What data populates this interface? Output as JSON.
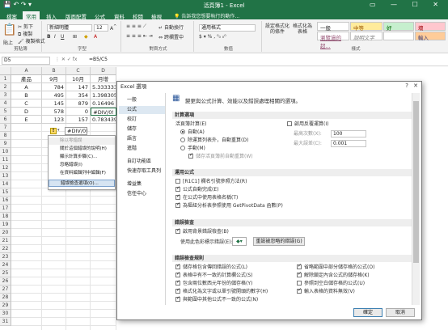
{
  "titlebar": {
    "title": "活頁簿1 - Excel"
  },
  "tabs": [
    "檔案",
    "常用",
    "插入",
    "版面配置",
    "公式",
    "資料",
    "校閱",
    "檢視",
    "說明"
  ],
  "tell_me": "告訴我您想要執行的動作...",
  "ribbon": {
    "paste": "貼上",
    "cut": "剪下",
    "copy": "複製",
    "format_painter": "複製格式",
    "clipboard_label": "剪貼簿",
    "font_name": "新細明體",
    "font_size": "12",
    "font_label": "字型",
    "wrap": "自動換行",
    "merge": "跨欄置中",
    "align_label": "對齊方式",
    "num_format": "通用格式",
    "num_label": "數值",
    "cond_format": "設定格式化的條件",
    "as_table": "格式化為表格",
    "styles": {
      "normal": "一般",
      "medium": "中等",
      "good": "好",
      "bad": "壞",
      "hyperlink": "瀏覽過的超...",
      "explanatory": "說明文字",
      "input": "輸入"
    },
    "styles_label": "樣式"
  },
  "formula_bar": {
    "name_box": "D5",
    "formula": "=B5/C5"
  },
  "sheet": {
    "cols": [
      "A",
      "B",
      "C",
      "D"
    ],
    "rows": [
      "1",
      "2",
      "3",
      "4",
      "5",
      "6",
      "7",
      "8",
      "9",
      "10",
      "11",
      "12",
      "13",
      "14",
      "15",
      "16",
      "17",
      "18",
      "19",
      "20",
      "21",
      "22",
      "23",
      "24",
      "25",
      "26",
      "27",
      "28",
      "29",
      "30",
      "31"
    ],
    "data": [
      [
        "產品",
        "9月",
        "10月",
        "月增"
      ],
      [
        "A",
        "784",
        "147",
        "5.333333"
      ],
      [
        "B",
        "495",
        "354",
        "1.398305"
      ],
      [
        "C",
        "145",
        "879",
        "0.16496"
      ],
      [
        "D",
        "578",
        "0",
        "#DIV/0!"
      ],
      [
        "E",
        "123",
        "157",
        "0.783439"
      ]
    ],
    "error_tag": "#DIV/0!"
  },
  "error_menu": [
    "除以零錯誤",
    "關於這個錯誤的說明(H)",
    "顯示計算步驟(C)...",
    "忽略錯誤(I)",
    "在資料編輯列中編輯(F)",
    "錯誤檢查選項(O)..."
  ],
  "dialog": {
    "title": "Excel 選項",
    "nav": [
      "一般",
      "公式",
      "校訂",
      "儲存",
      "語言",
      "進階",
      "自訂功能區",
      "快速存取工具列",
      "增益集",
      "信任中心"
    ],
    "header": "變更與公式計算、效能以及錯誤處理相關的選項。",
    "sec_calc": "計算選項",
    "workbook_calc": "活頁簿計算(E)",
    "calc_auto": "自動(A)",
    "calc_auto_except": "除運算列表外，自動重算(D)",
    "calc_manual": "手動(M)",
    "recalc_before_save": "儲存活頁簿前自動重算(W)",
    "iterative": "啟用反覆運算(I)",
    "max_iter_label": "最高次數(X):",
    "max_iter": "100",
    "max_change_label": "最大誤差(C):",
    "max_change": "0.001",
    "sec_formulas": "運用公式",
    "r1c1": "[R1C1] 欄名引號參照方法(R)",
    "autocomplete": "公式自動完成(E)",
    "table_names": "在公式中使用表格名稱(T)",
    "getpivot": "為樞紐分析表參照使用 GetPivotData 函數(P)",
    "sec_err": "錯誤檢查",
    "bg_check": "啟用背景錯誤檢查(B)",
    "err_color": "使用此色彩標示錯誤(E):",
    "reset_ignored": "重設被忽略的錯誤(G)",
    "sec_rules": "錯誤檢查規則",
    "rules_left": [
      "儲存格包含傳回錯誤的公式(L)",
      "表格中有不一致的計算欄公式(S)",
      "包含兩位數西元年份的儲存格(Y)",
      "格式化為文字或以單引號開頭的數字(H)",
      "與範圍中其他公式不一致的公式(N)"
    ],
    "rules_right": [
      "省略範圍中部分儲存格的公式(O)",
      "解除鎖定內含公式的儲存格(K)",
      "參照到空白儲存格的公式(U)",
      "輸入表格的資料無效(V)"
    ],
    "ok": "確定",
    "cancel": "取消"
  }
}
